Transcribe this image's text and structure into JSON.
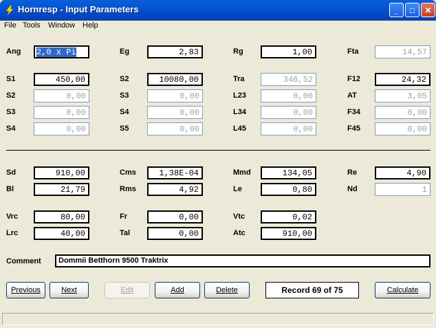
{
  "window": {
    "title": "Hornresp - Input Parameters",
    "controls": {
      "minimize": "_",
      "maximize": "□",
      "close": "✕"
    }
  },
  "menu": [
    "File",
    "Tools",
    "Window",
    "Help"
  ],
  "params": {
    "ang": {
      "label": "Ang",
      "value": "2,0 x Pi"
    },
    "eg": {
      "label": "Eg",
      "value": "2,83"
    },
    "rg": {
      "label": "Rg",
      "value": "1,00"
    },
    "fta": {
      "label": "Fta",
      "value": "14,57"
    },
    "s1": {
      "label": "S1",
      "value": "450,00"
    },
    "s2a": {
      "label": "S2",
      "value": "10080,00"
    },
    "tra": {
      "label": "Tra",
      "value": "346,52"
    },
    "f12": {
      "label": "F12",
      "value": "24,32"
    },
    "s2": {
      "label": "S2",
      "value": "0,00"
    },
    "s3a": {
      "label": "S3",
      "value": "0,00"
    },
    "l23": {
      "label": "L23",
      "value": "0,00"
    },
    "at": {
      "label": "AT",
      "value": "3,05"
    },
    "s3": {
      "label": "S3",
      "value": "0,00"
    },
    "s4a": {
      "label": "S4",
      "value": "0,00"
    },
    "l34": {
      "label": "L34",
      "value": "0,00"
    },
    "f34": {
      "label": "F34",
      "value": "0,00"
    },
    "s4": {
      "label": "S4",
      "value": "0,00"
    },
    "s5": {
      "label": "S5",
      "value": "0,00"
    },
    "l45": {
      "label": "L45",
      "value": "0,00"
    },
    "f45": {
      "label": "F45",
      "value": "0,00"
    },
    "sd": {
      "label": "Sd",
      "value": "910,00"
    },
    "cms": {
      "label": "Cms",
      "value": "1,38E-04"
    },
    "mmd": {
      "label": "Mmd",
      "value": "134,05"
    },
    "re": {
      "label": "Re",
      "value": "4,90"
    },
    "bl": {
      "label": "Bl",
      "value": "21,79"
    },
    "rms": {
      "label": "Rms",
      "value": "4,92"
    },
    "le": {
      "label": "Le",
      "value": "0,80"
    },
    "nd": {
      "label": "Nd",
      "value": "1"
    },
    "vrc": {
      "label": "Vrc",
      "value": "80,00"
    },
    "fr": {
      "label": "Fr",
      "value": "0,00"
    },
    "vtc": {
      "label": "Vtc",
      "value": "0,02"
    },
    "lrc": {
      "label": "Lrc",
      "value": "40,00"
    },
    "tal": {
      "label": "Tal",
      "value": "0,00"
    },
    "atc": {
      "label": "Atc",
      "value": "910,00"
    }
  },
  "comment": {
    "label": "Comment",
    "value": "Dommii Betthorn 9500 Traktrix"
  },
  "buttons": {
    "previous": "Previous",
    "next": "Next",
    "edit": "Edit",
    "add": "Add",
    "delete": "Delete",
    "calculate": "Calculate"
  },
  "record_status": "Record 69 of 75",
  "colors": {
    "title_bar": "#0454d2",
    "window_bg": "#ece9d8",
    "selection": "#316ac5",
    "disabled_text": "#a0a0a0"
  }
}
